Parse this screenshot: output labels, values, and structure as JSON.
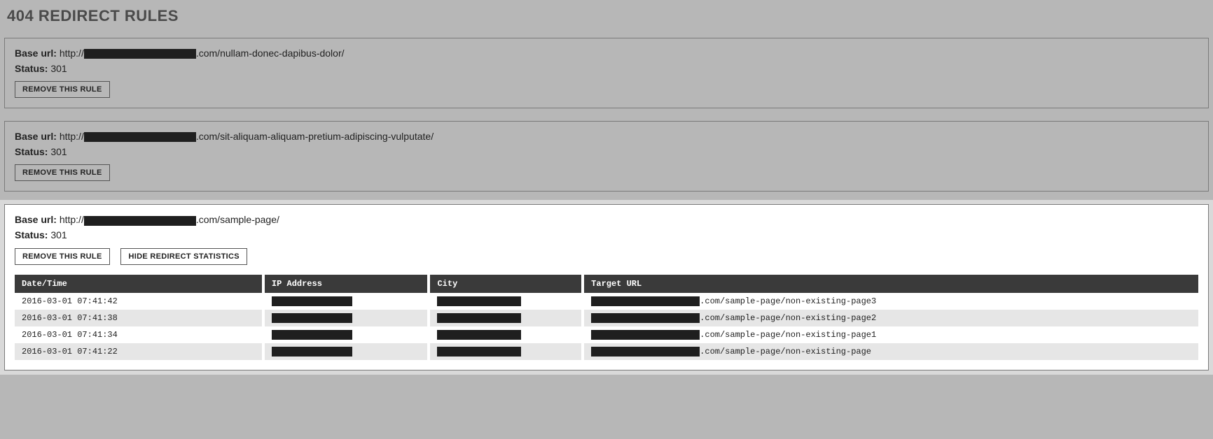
{
  "page_title": "404 REDIRECT RULES",
  "labels": {
    "base_url": "Base url:",
    "status": "Status:",
    "remove_rule": "REMOVE THIS RULE",
    "hide_stats": "HIDE REDIRECT STATISTICS"
  },
  "rules": [
    {
      "url_prefix": "http://",
      "url_suffix": ".com/nullam-donec-dapibus-dolor/",
      "status": "301",
      "expanded": false
    },
    {
      "url_prefix": "http://",
      "url_suffix": ".com/sit-aliquam-aliquam-pretium-adipiscing-vulputate/",
      "status": "301",
      "expanded": false
    },
    {
      "url_prefix": "http://",
      "url_suffix": ".com/sample-page/",
      "status": "301",
      "expanded": true
    }
  ],
  "stats_table": {
    "headers": {
      "datetime": "Date/Time",
      "ip": "IP Address",
      "city": "City",
      "target": "Target URL"
    },
    "rows": [
      {
        "datetime": "2016-03-01 07:41:42",
        "target_suffix": ".com/sample-page/non-existing-page3"
      },
      {
        "datetime": "2016-03-01 07:41:38",
        "target_suffix": ".com/sample-page/non-existing-page2"
      },
      {
        "datetime": "2016-03-01 07:41:34",
        "target_suffix": ".com/sample-page/non-existing-page1"
      },
      {
        "datetime": "2016-03-01 07:41:22",
        "target_suffix": ".com/sample-page/non-existing-page"
      }
    ]
  }
}
